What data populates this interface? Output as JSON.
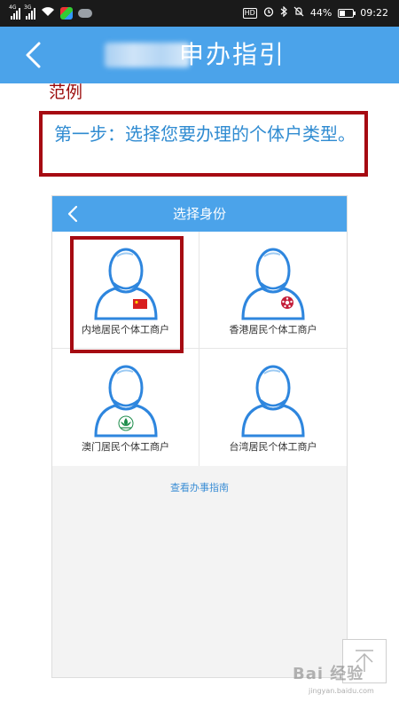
{
  "status_bar": {
    "network_a": "4G",
    "network_b": "3G",
    "battery": "44%",
    "battery_level": 0.44,
    "time": "09:22",
    "hd_label": "HD"
  },
  "header": {
    "title": "申办指引"
  },
  "content": {
    "example_label": "范例",
    "step_text": "第一步：选择您要办理的个体户类型。"
  },
  "card": {
    "title": "选择身份",
    "options": [
      {
        "label": "内地居民个体工商户",
        "badge": "china-flag"
      },
      {
        "label": "香港居民个体工商户",
        "badge": "hong-kong-flag"
      },
      {
        "label": "澳门居民个体工商户",
        "badge": "macau-flag"
      },
      {
        "label": "台湾居民个体工商户",
        "badge": "none"
      }
    ],
    "guide_link": "查看办事指南"
  },
  "watermark": {
    "text": "Bai 经验",
    "sub": "jingyan.baidu.com"
  },
  "colors": {
    "header_blue": "#4ba3ea",
    "annotation_red": "#a60a12",
    "step_text_blue": "#2f8bd1",
    "icon_blue": "#2e86de"
  }
}
